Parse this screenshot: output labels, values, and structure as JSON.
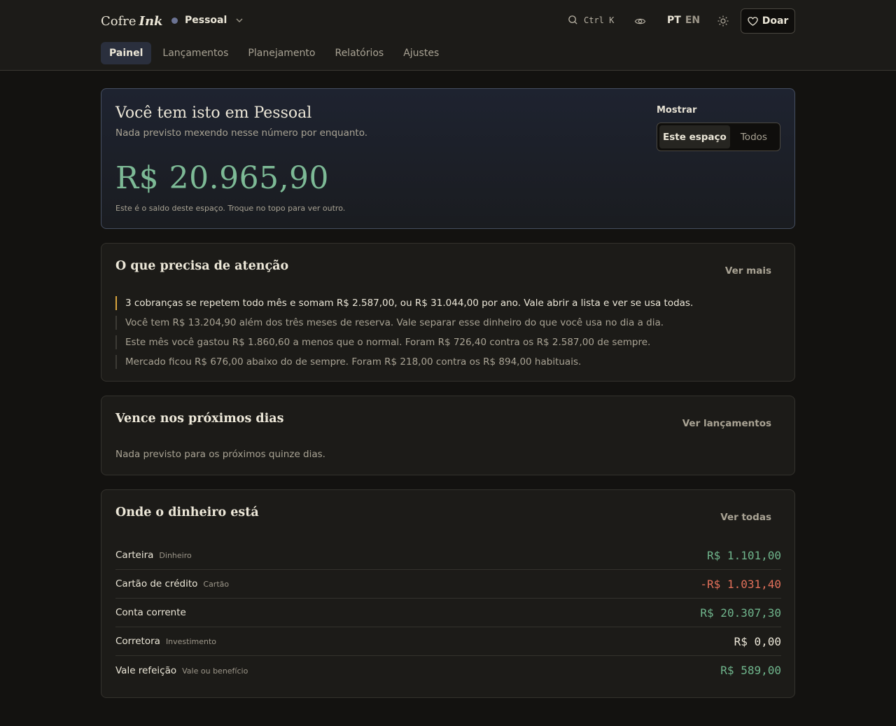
{
  "app": {
    "logo_main": "Cofre",
    "logo_accent": "Ink"
  },
  "header": {
    "space": "Pessoal",
    "search_shortcut": "Ctrl K",
    "lang_active": "PT",
    "lang_other": "EN",
    "donate_label": "Doar"
  },
  "tabs": [
    "Painel",
    "Lançamentos",
    "Planejamento",
    "Relatórios",
    "Ajustes"
  ],
  "hero": {
    "title": "Você tem isto em Pessoal",
    "subtitle": "Nada previsto mexendo nesse número por enquanto.",
    "amount": "R$ 20.965,90",
    "note": "Este é o saldo deste espaço. Troque no topo para ver outro.",
    "show_label": "Mostrar",
    "toggle_active": "Este espaço",
    "toggle_other": "Todos"
  },
  "attention": {
    "title": "O que precisa de atenção",
    "link": "Ver mais",
    "items": [
      "3 cobranças se repetem todo mês e somam R$ 2.587,00, ou R$ 31.044,00 por ano. Vale abrir a lista e ver se usa todas.",
      "Você tem R$ 13.204,90 além dos três meses de reserva. Vale separar esse dinheiro do que você usa no dia a dia.",
      "Este mês você gastou R$ 1.860,60 a menos que o normal. Foram R$ 726,40 contra os R$ 2.587,00 de sempre.",
      "Mercado ficou R$ 676,00 abaixo do de sempre. Foram R$ 218,00 contra os R$ 894,00 habituais."
    ]
  },
  "upcoming": {
    "title": "Vence nos próximos dias",
    "link": "Ver lançamentos",
    "empty": "Nada previsto para os próximos quinze dias."
  },
  "accounts": {
    "title": "Onde o dinheiro está",
    "link": "Ver todas",
    "rows": [
      {
        "name": "Carteira",
        "type": "Dinheiro",
        "amount": "R$ 1.101,00"
      },
      {
        "name": "Cartão de crédito",
        "type": "Cartão",
        "amount": "-R$ 1.031,40"
      },
      {
        "name": "Conta corrente",
        "type": "",
        "amount": "R$ 20.307,30"
      },
      {
        "name": "Corretora",
        "type": "Investimento",
        "amount": "R$ 0,00"
      },
      {
        "name": "Vale refeição",
        "type": "Vale ou benefício",
        "amount": "R$ 589,00"
      }
    ]
  },
  "colors": {
    "positive": "#6fb58c",
    "negative": "#e2705a",
    "warning": "#d9a53d",
    "hero_amount": "#7dba96"
  }
}
